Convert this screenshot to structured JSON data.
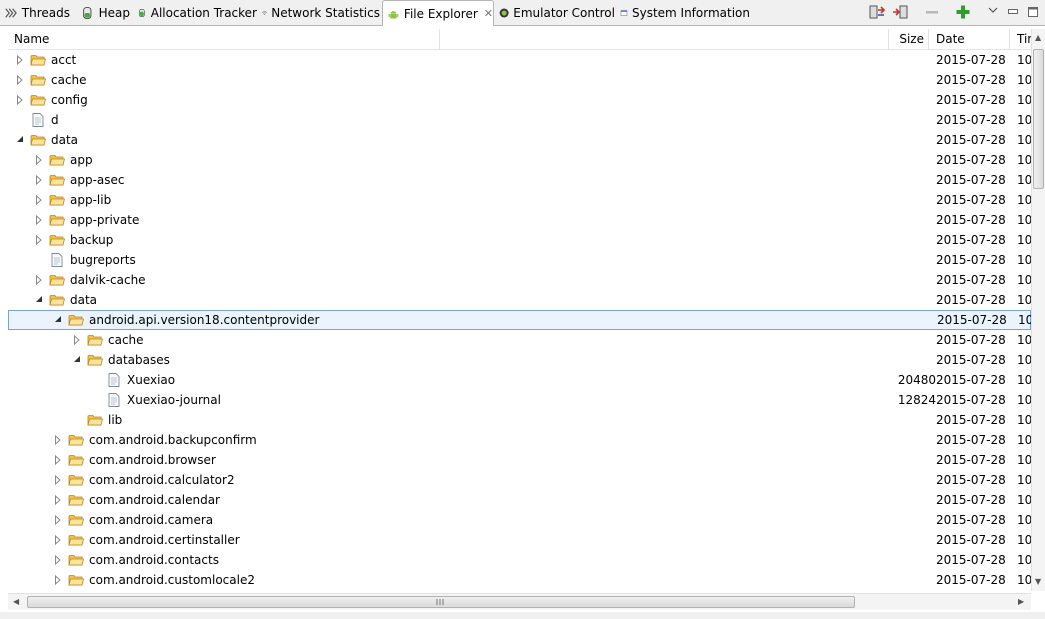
{
  "tabs": [
    {
      "label": "Threads",
      "icon": "threads-icon",
      "active": false
    },
    {
      "label": "Heap",
      "icon": "heap-icon",
      "active": false
    },
    {
      "label": "Allocation Tracker",
      "icon": "allocation-tracker-icon",
      "active": false
    },
    {
      "label": "Network Statistics",
      "icon": "wifi-icon",
      "active": false
    },
    {
      "label": "File Explorer",
      "icon": "android-icon",
      "active": true
    },
    {
      "label": "Emulator Control",
      "icon": "emulator-icon",
      "active": false
    },
    {
      "label": "System Information",
      "icon": "window-icon",
      "active": false
    }
  ],
  "toolbar": {
    "icons": [
      "pull-file-icon",
      "push-file-icon",
      "delete-icon",
      "new-folder-icon",
      "view-menu-icon",
      "minimize-icon",
      "maximize-icon"
    ]
  },
  "columns": {
    "name": "Name",
    "size": "Size",
    "date": "Date",
    "time": "Time"
  },
  "files": [
    {
      "name": "acct",
      "type": "folder",
      "depth": 0,
      "expanded": false,
      "size": "",
      "date": "2015-07-28",
      "time": "10"
    },
    {
      "name": "cache",
      "type": "folder",
      "depth": 0,
      "expanded": false,
      "size": "",
      "date": "2015-07-28",
      "time": "10"
    },
    {
      "name": "config",
      "type": "folder",
      "depth": 0,
      "expanded": false,
      "size": "",
      "date": "2015-07-28",
      "time": "10"
    },
    {
      "name": "d",
      "type": "file",
      "depth": 0,
      "size": "",
      "date": "2015-07-28",
      "time": "10"
    },
    {
      "name": "data",
      "type": "folder",
      "depth": 0,
      "expanded": true,
      "size": "",
      "date": "2015-07-28",
      "time": "10"
    },
    {
      "name": "app",
      "type": "folder",
      "depth": 1,
      "expanded": false,
      "size": "",
      "date": "2015-07-28",
      "time": "10"
    },
    {
      "name": "app-asec",
      "type": "folder",
      "depth": 1,
      "expanded": false,
      "size": "",
      "date": "2015-07-28",
      "time": "10"
    },
    {
      "name": "app-lib",
      "type": "folder",
      "depth": 1,
      "expanded": false,
      "size": "",
      "date": "2015-07-28",
      "time": "10"
    },
    {
      "name": "app-private",
      "type": "folder",
      "depth": 1,
      "expanded": false,
      "size": "",
      "date": "2015-07-28",
      "time": "10"
    },
    {
      "name": "backup",
      "type": "folder",
      "depth": 1,
      "expanded": false,
      "size": "",
      "date": "2015-07-28",
      "time": "10"
    },
    {
      "name": "bugreports",
      "type": "file",
      "depth": 1,
      "size": "",
      "date": "2015-07-28",
      "time": "10"
    },
    {
      "name": "dalvik-cache",
      "type": "folder",
      "depth": 1,
      "expanded": false,
      "size": "",
      "date": "2015-07-28",
      "time": "10"
    },
    {
      "name": "data",
      "type": "folder",
      "depth": 1,
      "expanded": true,
      "size": "",
      "date": "2015-07-28",
      "time": "10"
    },
    {
      "name": "android.api.version18.contentprovider",
      "type": "folder",
      "depth": 2,
      "expanded": true,
      "selected": true,
      "size": "",
      "date": "2015-07-28",
      "time": "10"
    },
    {
      "name": "cache",
      "type": "folder",
      "depth": 3,
      "expanded": false,
      "size": "",
      "date": "2015-07-28",
      "time": "10"
    },
    {
      "name": "databases",
      "type": "folder",
      "depth": 3,
      "expanded": true,
      "size": "",
      "date": "2015-07-28",
      "time": "10"
    },
    {
      "name": "Xuexiao",
      "type": "file",
      "depth": 4,
      "size": "20480",
      "date": "2015-07-28",
      "time": "10"
    },
    {
      "name": "Xuexiao-journal",
      "type": "file",
      "depth": 4,
      "size": "12824",
      "date": "2015-07-28",
      "time": "10"
    },
    {
      "name": "lib",
      "type": "folder",
      "depth": 3,
      "leaf": true,
      "size": "",
      "date": "2015-07-28",
      "time": "10"
    },
    {
      "name": "com.android.backupconfirm",
      "type": "folder",
      "depth": 2,
      "expanded": false,
      "size": "",
      "date": "2015-07-28",
      "time": "10"
    },
    {
      "name": "com.android.browser",
      "type": "folder",
      "depth": 2,
      "expanded": false,
      "size": "",
      "date": "2015-07-28",
      "time": "10"
    },
    {
      "name": "com.android.calculator2",
      "type": "folder",
      "depth": 2,
      "expanded": false,
      "size": "",
      "date": "2015-07-28",
      "time": "10"
    },
    {
      "name": "com.android.calendar",
      "type": "folder",
      "depth": 2,
      "expanded": false,
      "size": "",
      "date": "2015-07-28",
      "time": "10"
    },
    {
      "name": "com.android.camera",
      "type": "folder",
      "depth": 2,
      "expanded": false,
      "size": "",
      "date": "2015-07-28",
      "time": "10"
    },
    {
      "name": "com.android.certinstaller",
      "type": "folder",
      "depth": 2,
      "expanded": false,
      "size": "",
      "date": "2015-07-28",
      "time": "10"
    },
    {
      "name": "com.android.contacts",
      "type": "folder",
      "depth": 2,
      "expanded": false,
      "size": "",
      "date": "2015-07-28",
      "time": "10"
    },
    {
      "name": "com.android.customlocale2",
      "type": "folder",
      "depth": 2,
      "expanded": false,
      "size": "",
      "date": "2015-07-28",
      "time": "10"
    }
  ],
  "colors": {
    "selection_bg": "#ebf4fd",
    "selection_border": "#7da2ce",
    "folder": "#f5c342"
  }
}
